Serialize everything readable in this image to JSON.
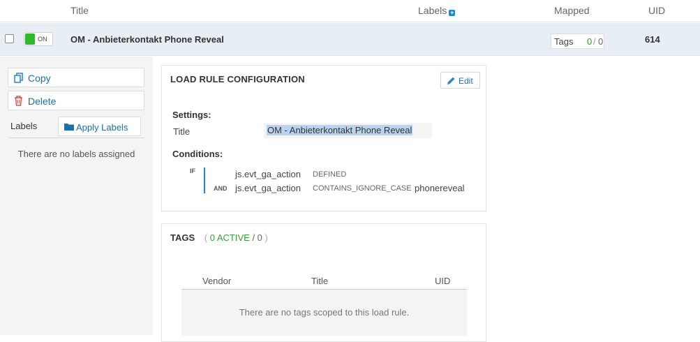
{
  "header": {
    "title_col": "Title",
    "labels_col": "Labels",
    "labels_add_icon": "plus-icon",
    "mapped_col": "Mapped",
    "uid_col": "UID"
  },
  "row": {
    "toggle_label": "ON",
    "toggle_color": "#2eb82e",
    "title": "OM - Anbieterkontakt Phone Reveal",
    "tags_label": "Tags",
    "tags_active": "0",
    "tags_sep": "/",
    "tags_total": "0",
    "uid": "614"
  },
  "actions": {
    "copy_label": "Copy",
    "delete_label": "Delete",
    "labels_title": "Labels",
    "apply_labels_label": "Apply Labels",
    "no_labels_text": "There are no labels assigned"
  },
  "config": {
    "heading": "LOAD RULE CONFIGURATION",
    "edit_label": "Edit",
    "settings_label": "Settings:",
    "title_field_label": "Title",
    "title_value": "OM - Anbieterkontakt Phone Reveal",
    "conditions_label": "Conditions:",
    "if_kw": "IF",
    "and_kw": "AND",
    "conditions": [
      {
        "variable": "js.evt_ga_action",
        "operator": "DEFINED",
        "value": ""
      },
      {
        "variable": "js.evt_ga_action",
        "operator": "CONTAINS_IGNORE_CASE",
        "value": "phonereveal"
      }
    ]
  },
  "tags": {
    "heading": "TAGS",
    "open_paren": "(",
    "active_text": "0 ACTIVE",
    "total_text": "/ 0",
    "close_paren": ")",
    "columns": [
      "Vendor",
      "Title",
      "UID"
    ],
    "empty_text": "There are no tags scoped to this load rule."
  },
  "colors": {
    "accent": "#1d6fa8",
    "active_green": "#3a9a3a",
    "selected_row": "#e8eef6"
  }
}
